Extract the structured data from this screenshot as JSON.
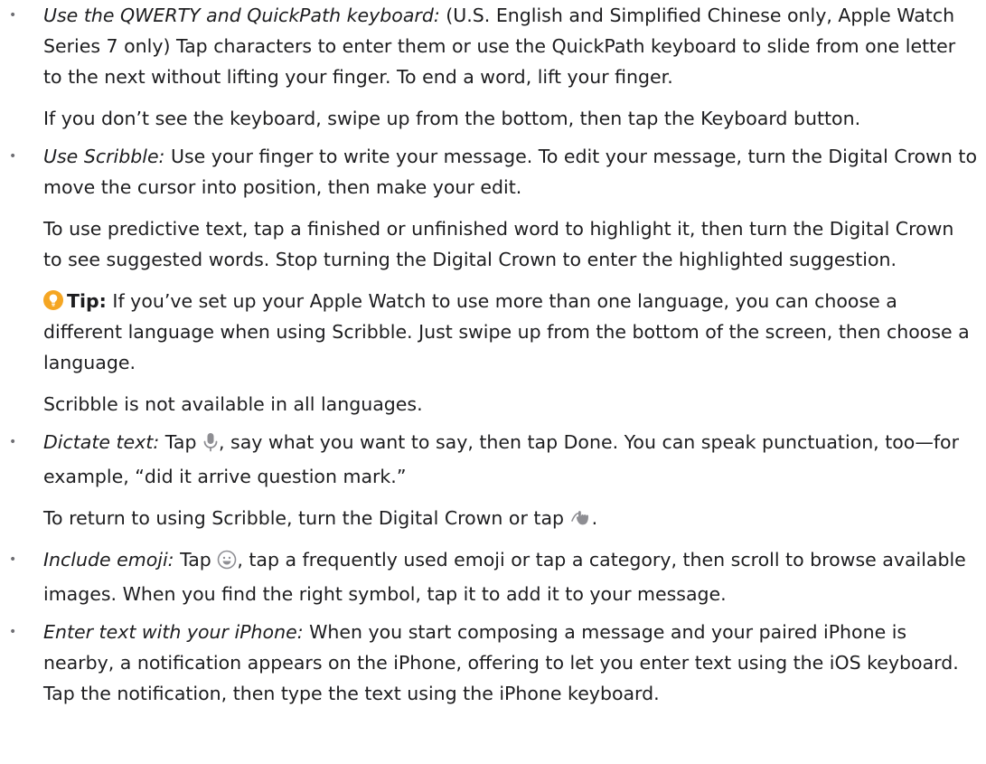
{
  "items": [
    {
      "lead": "Use the QWERTY and QuickPath keyboard:",
      "text": " (U.S. English and Simplified Chinese only, Apple Watch Series 7 only) Tap characters to enter them or use the QuickPath keyboard to slide from one letter to the next without lifting your finger. To end a word, lift your finger.",
      "sub": "If you don’t see the keyboard, swipe up from the bottom, then tap the Keyboard button."
    },
    {
      "lead": "Use Scribble:",
      "text": " Use your finger to write your message. To edit your message, turn the Digital Crown to move the cursor into position, then make your edit.",
      "sub1": "To use predictive text, tap a finished or unfinished word to highlight it, then turn the Digital Crown to see suggested words. Stop turning the Digital Crown to enter the highlighted suggestion.",
      "tip_label": "Tip:",
      "tip_text": " If you’ve set up your Apple Watch to use more than one language, you can choose a different language when using Scribble. Just swipe up from the bottom of the screen, then choose a language.",
      "sub2": "Scribble is not available in all languages."
    },
    {
      "lead": "Dictate text:",
      "text_a": " Tap ",
      "text_b": ", say what you want to say, then tap Done. You can speak punctuation, too—for example, “did it arrive question mark.”",
      "sub_a": "To return to using Scribble, turn the Digital Crown or tap ",
      "sub_b": "."
    },
    {
      "lead": "Include emoji:",
      "text_a": " Tap ",
      "text_b": ", tap a frequently used emoji or tap a category, then scroll to browse available images. When you find the right symbol, tap it to add it to your message."
    },
    {
      "lead": "Enter text with your iPhone:",
      "text": " When you start composing a message and your paired iPhone is nearby, a notification appears on the iPhone, offering to let you enter text using the iOS keyboard. Tap the notification, then type the text using the iPhone keyboard."
    }
  ],
  "colors": {
    "text": "#1d1d1f",
    "tip_icon": "#f5a623",
    "icon_gray": "#8e8e93"
  }
}
